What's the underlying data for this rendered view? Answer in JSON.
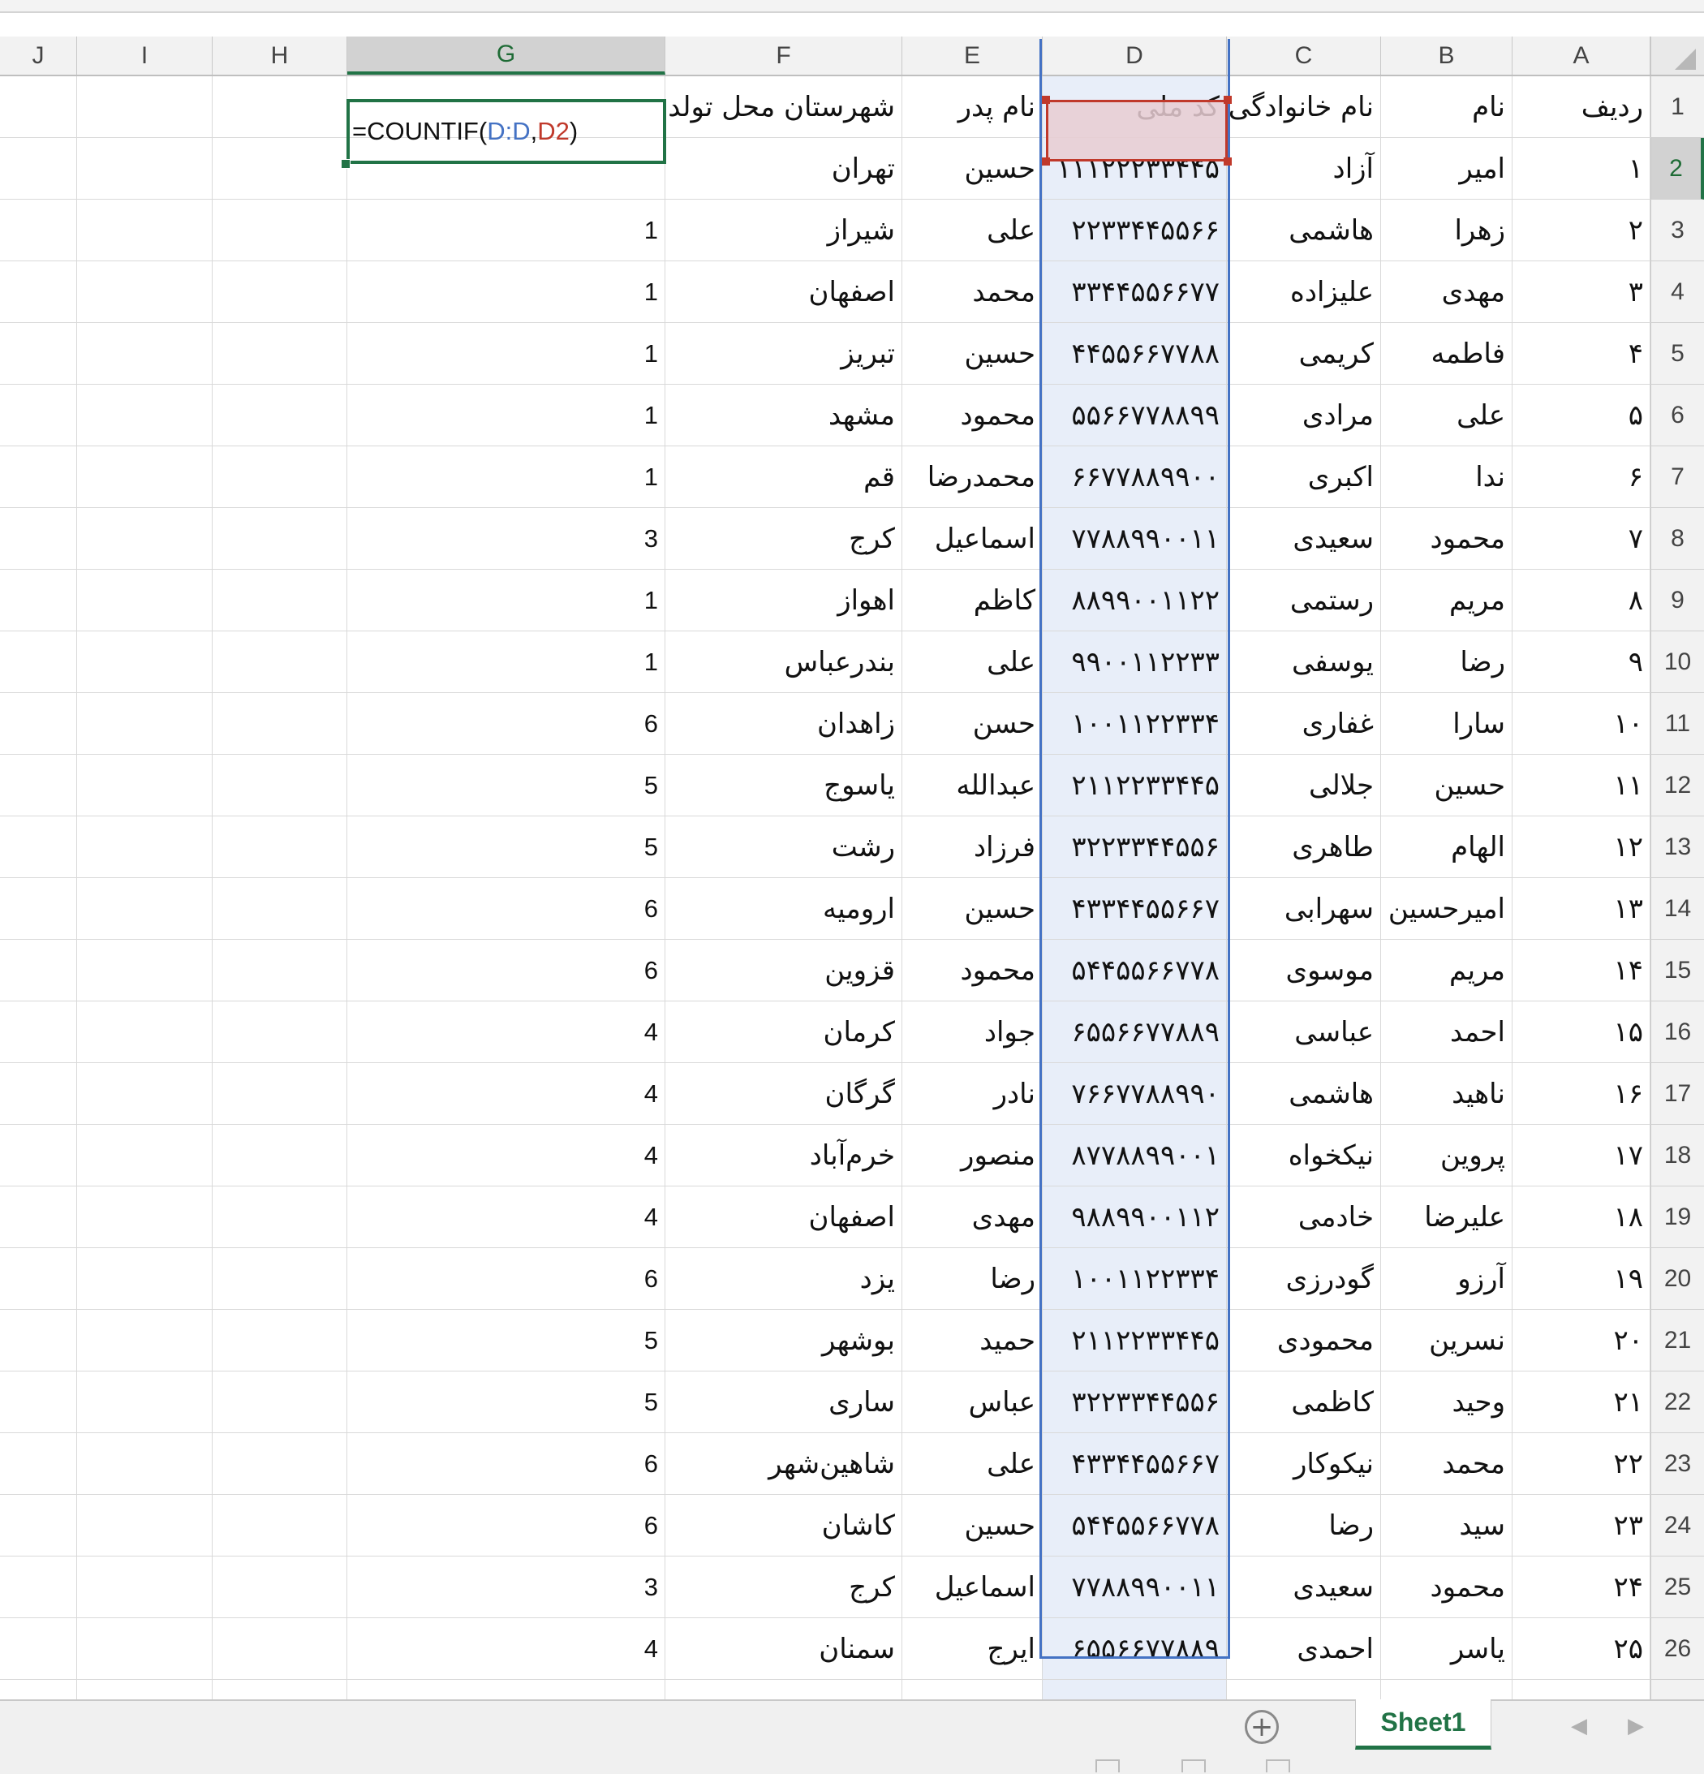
{
  "columns": [
    "J",
    "I",
    "H",
    "G",
    "F",
    "E",
    "D",
    "C",
    "B",
    "A"
  ],
  "headers": {
    "A": "ردیف",
    "B": "نام",
    "C": "نام خانوادگی",
    "D": "کد ملی",
    "E": "نام پدر",
    "F": "شهرستان محل تولد"
  },
  "formula": {
    "prefix": "=COUNTIF(",
    "ref1": "D:D",
    "comma": ",",
    "ref2": "D2",
    "suffix": ")"
  },
  "rows": [
    {
      "n": "2",
      "a": "۱",
      "b": "امیر",
      "c": "آزاد",
      "d": "۱۱۱۲۲۲۳۳۴۴۵",
      "e": "حسین",
      "f": "تهران",
      "g": ""
    },
    {
      "n": "3",
      "a": "۲",
      "b": "زهرا",
      "c": "هاشمی",
      "d": "۲۲۳۳۴۴۵۵۶۶",
      "e": "علی",
      "f": "شیراز",
      "g": "1"
    },
    {
      "n": "4",
      "a": "۳",
      "b": "مهدی",
      "c": "علیزاده",
      "d": "۳۳۴۴۵۵۶۶۷۷",
      "e": "محمد",
      "f": "اصفهان",
      "g": "1"
    },
    {
      "n": "5",
      "a": "۴",
      "b": "فاطمه",
      "c": "کریمی",
      "d": "۴۴۵۵۶۶۷۷۸۸",
      "e": "حسین",
      "f": "تبریز",
      "g": "1"
    },
    {
      "n": "6",
      "a": "۵",
      "b": "علی",
      "c": "مرادی",
      "d": "۵۵۶۶۷۷۸۸۹۹",
      "e": "محمود",
      "f": "مشهد",
      "g": "1"
    },
    {
      "n": "7",
      "a": "۶",
      "b": "ندا",
      "c": "اکبری",
      "d": "۶۶۷۷۸۸۹۹۰۰",
      "e": "محمدرضا",
      "f": "قم",
      "g": "1"
    },
    {
      "n": "8",
      "a": "۷",
      "b": "محمود",
      "c": "سعیدی",
      "d": "۷۷۸۸۹۹۰۰۱۱",
      "e": "اسماعیل",
      "f": "کرج",
      "g": "3"
    },
    {
      "n": "9",
      "a": "۸",
      "b": "مریم",
      "c": "رستمی",
      "d": "۸۸۹۹۰۰۱۱۲۲",
      "e": "کاظم",
      "f": "اهواز",
      "g": "1"
    },
    {
      "n": "10",
      "a": "۹",
      "b": "رضا",
      "c": "یوسفی",
      "d": "۹۹۰۰۱۱۲۲۳۳",
      "e": "علی",
      "f": "بندرعباس",
      "g": "1"
    },
    {
      "n": "11",
      "a": "۱۰",
      "b": "سارا",
      "c": "غفاری",
      "d": "۱۰۰۱۱۲۲۳۳۴",
      "e": "حسن",
      "f": "زاهدان",
      "g": "6"
    },
    {
      "n": "12",
      "a": "۱۱",
      "b": "حسین",
      "c": "جلالی",
      "d": "۲۱۱۲۲۳۳۴۴۵",
      "e": "عبدالله",
      "f": "یاسوج",
      "g": "5"
    },
    {
      "n": "13",
      "a": "۱۲",
      "b": "الهام",
      "c": "طاهری",
      "d": "۳۲۲۳۳۴۴۵۵۶",
      "e": "فرزاد",
      "f": "رشت",
      "g": "5"
    },
    {
      "n": "14",
      "a": "۱۳",
      "b": "امیرحسین",
      "c": "سهرابی",
      "d": "۴۳۳۴۴۵۵۶۶۷",
      "e": "حسین",
      "f": "ارومیه",
      "g": "6"
    },
    {
      "n": "15",
      "a": "۱۴",
      "b": "مریم",
      "c": "موسوی",
      "d": "۵۴۴۵۵۶۶۷۷۸",
      "e": "محمود",
      "f": "قزوین",
      "g": "6"
    },
    {
      "n": "16",
      "a": "۱۵",
      "b": "احمد",
      "c": "عباسی",
      "d": "۶۵۵۶۶۷۷۸۸۹",
      "e": "جواد",
      "f": "کرمان",
      "g": "4"
    },
    {
      "n": "17",
      "a": "۱۶",
      "b": "ناهید",
      "c": "هاشمی",
      "d": "۷۶۶۷۷۸۸۹۹۰",
      "e": "نادر",
      "f": "گرگان",
      "g": "4"
    },
    {
      "n": "18",
      "a": "۱۷",
      "b": "پروین",
      "c": "نیکخواه",
      "d": "۸۷۷۸۸۹۹۰۰۱",
      "e": "منصور",
      "f": "خرم‌آباد",
      "g": "4"
    },
    {
      "n": "19",
      "a": "۱۸",
      "b": "علیرضا",
      "c": "خادمی",
      "d": "۹۸۸۹۹۰۰۱۱۲",
      "e": "مهدی",
      "f": "اصفهان",
      "g": "4"
    },
    {
      "n": "20",
      "a": "۱۹",
      "b": "آرزو",
      "c": "گودرزی",
      "d": "۱۰۰۱۱۲۲۳۳۴",
      "e": "رضا",
      "f": "یزد",
      "g": "6"
    },
    {
      "n": "21",
      "a": "۲۰",
      "b": "نسرین",
      "c": "محمودی",
      "d": "۲۱۱۲۲۳۳۴۴۵",
      "e": "حمید",
      "f": "بوشهر",
      "g": "5"
    },
    {
      "n": "22",
      "a": "۲۱",
      "b": "وحید",
      "c": "کاظمی",
      "d": "۳۲۲۳۳۴۴۵۵۶",
      "e": "عباس",
      "f": "ساری",
      "g": "5"
    },
    {
      "n": "23",
      "a": "۲۲",
      "b": "محمد",
      "c": "نیکوکار",
      "d": "۴۳۳۴۴۵۵۶۶۷",
      "e": "علی",
      "f": "شاهین‌شهر",
      "g": "6"
    },
    {
      "n": "24",
      "a": "۲۳",
      "b": "سید",
      "c": "رضا",
      "d": "۵۴۴۵۵۶۶۷۷۸",
      "e": "حسین",
      "f": "کاشان",
      "g": "6"
    },
    {
      "n": "25",
      "a": "۲۴",
      "b": "محمود",
      "c": "سعیدی",
      "d": "۷۷۸۸۹۹۰۰۱۱",
      "e": "اسماعیل",
      "f": "کرج",
      "g": "3"
    },
    {
      "n": "26",
      "a": "۲۵",
      "b": "یاسر",
      "c": "احمدی",
      "d": "۶۵۵۶۶۷۷۸۸۹",
      "e": "ایرج",
      "f": "سمنان",
      "g": "4"
    }
  ],
  "header_row_number": "1",
  "sheet_tab": "Sheet1",
  "add_sheet_symbol": "+",
  "nav_prev": "◀",
  "nav_next": "▶",
  "colors": {
    "accent": "#217346",
    "d_highlight": "#e8eef9",
    "ref_blue": "#4472c4",
    "ref_red": "#c0392b"
  }
}
